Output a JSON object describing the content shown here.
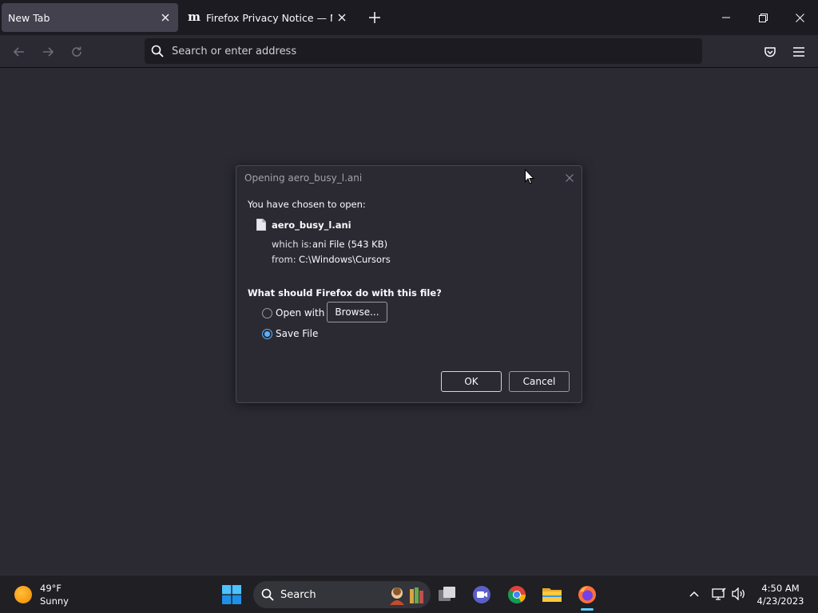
{
  "browser": {
    "tabs": [
      {
        "title": "New Tab",
        "active": true
      },
      {
        "title": "Firefox Privacy Notice — Mozilla",
        "active": false,
        "icon_glyph": "m"
      }
    ],
    "urlbar": {
      "placeholder": "Search or enter address"
    }
  },
  "dialog": {
    "title": "Opening aero_busy_l.ani",
    "chosen_label": "You have chosen to open:",
    "file_name": "aero_busy_l.ani",
    "which_is_label": "which is:",
    "which_is_value": "ani File (543 KB)",
    "from_label": "from:",
    "from_value": "C:\\Windows\\Cursors",
    "question": "What should Firefox do with this file?",
    "open_with_label": "Open with",
    "browse_label": "Browse...",
    "save_file_label": "Save File",
    "selected_option": "save_file",
    "ok_label": "OK",
    "cancel_label": "Cancel"
  },
  "taskbar": {
    "weather_temp": "49°F",
    "weather_cond": "Sunny",
    "search_label": "Search",
    "time": "4:50 AM",
    "date": "4/23/2023"
  },
  "colors": {
    "chrome_dark": "#1c1b22",
    "content_bg": "#2b2a33",
    "active_tab": "#42414d",
    "radio_accent": "#5bb1ff",
    "taskbar_indicator": "#60cdff"
  }
}
